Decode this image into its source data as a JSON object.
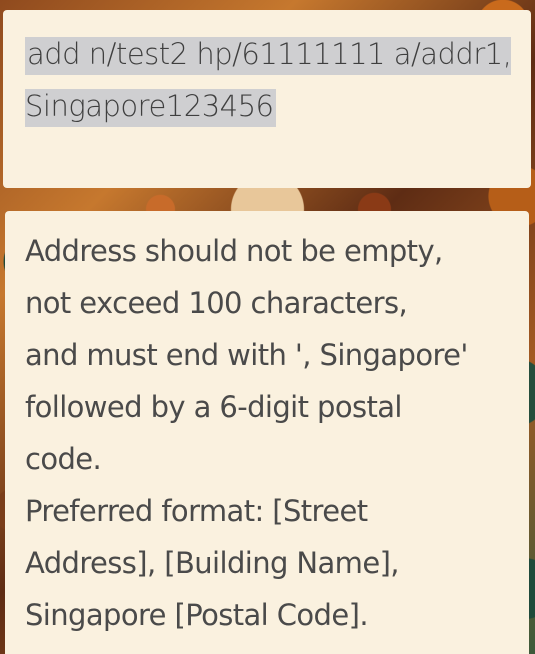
{
  "command_box": {
    "input_value": "add n/test2 hp/61111111 a/addr1, Singapore123456"
  },
  "result_box": {
    "message": "Address should not be empty,\nnot exceed 100 characters,\nand must end with ', Singapore'\nfollowed by a 6-digit postal\ncode.\nPreferred format: [Street\nAddress], [Building Name],\nSingapore [Postal Code]."
  }
}
